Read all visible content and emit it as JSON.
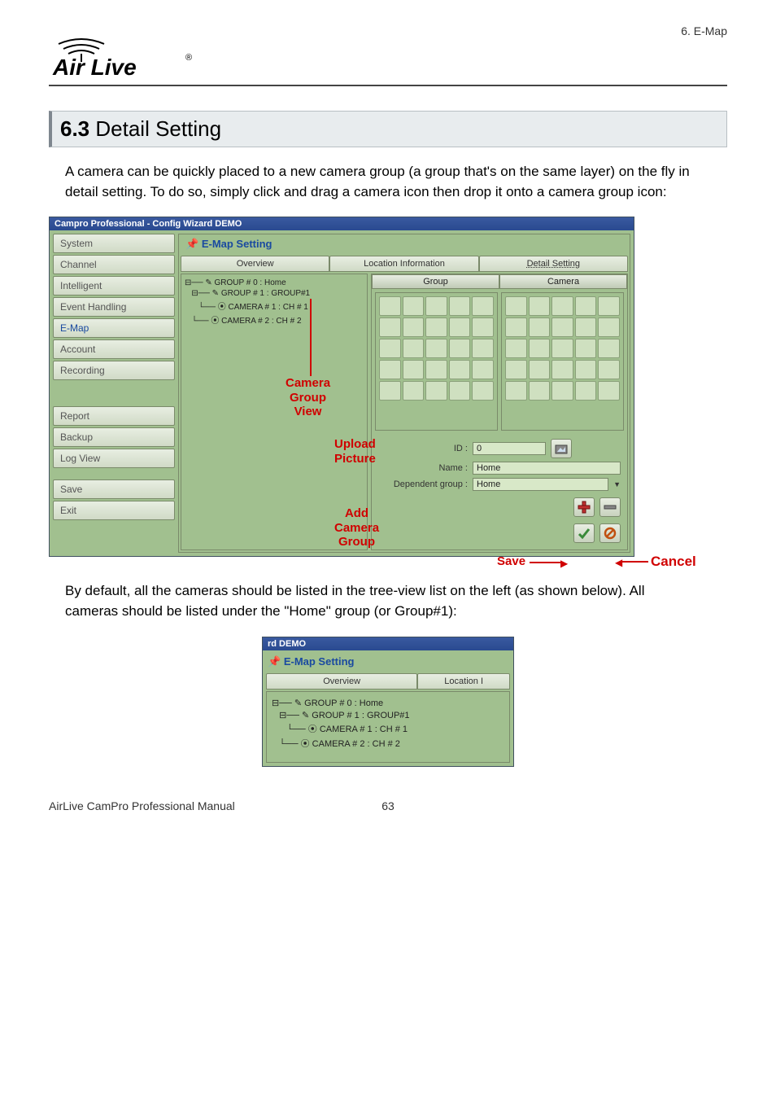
{
  "header": {
    "breadcrumb": "6. E-Map"
  },
  "logo": {
    "brand_text": "Air Live",
    "registered": "®"
  },
  "section": {
    "num": "6.3",
    "title": "Detail Setting"
  },
  "para1": "A camera can be quickly placed to a new camera group (a group that's on the same layer) on the fly in detail setting. To do so, simply click and drag a camera icon then drop it onto a camera group icon:",
  "para2": "By default, all the cameras should be listed in the tree-view list on the left (as shown below). All cameras should be listed under the \"Home\" group (or Group#1):",
  "footer": {
    "manual": "AirLive CamPro Professional Manual",
    "page": "63"
  },
  "shot1": {
    "title": "Campro Professional - Config Wizard DEMO",
    "sidebar": [
      "System",
      "Channel",
      "Intelligent",
      "Event Handling",
      "E-Map",
      "Account",
      "Recording",
      "__spacer__",
      "Report",
      "Backup",
      "Log View",
      "__spacer_small__",
      "Save",
      "Exit"
    ],
    "sidebar_active_index": 4,
    "panel_title": "E-Map Setting",
    "tabs": [
      "Overview",
      "Location Information",
      "Detail Setting"
    ],
    "tabs_active_index": 2,
    "tree": [
      "⊟── ✎ GROUP # 0 : Home",
      "   ⊟── ✎ GROUP # 1 : GROUP#1",
      "      └── ⦿ CAMERA # 1 : CH # 1",
      "   └── ⦿ CAMERA # 2 : CH # 2"
    ],
    "palette_headers": [
      "Group",
      "Camera"
    ],
    "form": {
      "id_label": "ID :",
      "id_value": "0",
      "name_label": "Name :",
      "name_value": "Home",
      "dep_label": "Dependent group :",
      "dep_value": "Home"
    },
    "anno": {
      "cgv": "Camera\nGroup\nView",
      "upload": "Upload\nPicture",
      "addcg": "Add\nCamera\nGroup",
      "save": "Save",
      "cancel": "Cancel"
    }
  },
  "shot2": {
    "title_frag": "rd DEMO",
    "panel_title": "E-Map Setting",
    "tabs": [
      "Overview",
      "Location I"
    ],
    "tree": [
      "⊟── ✎ GROUP # 0 : Home",
      "   ⊟── ✎ GROUP # 1 : GROUP#1",
      "      └── ⦿ CAMERA # 1 : CH # 1",
      "   └── ⦿ CAMERA # 2 : CH # 2"
    ]
  }
}
